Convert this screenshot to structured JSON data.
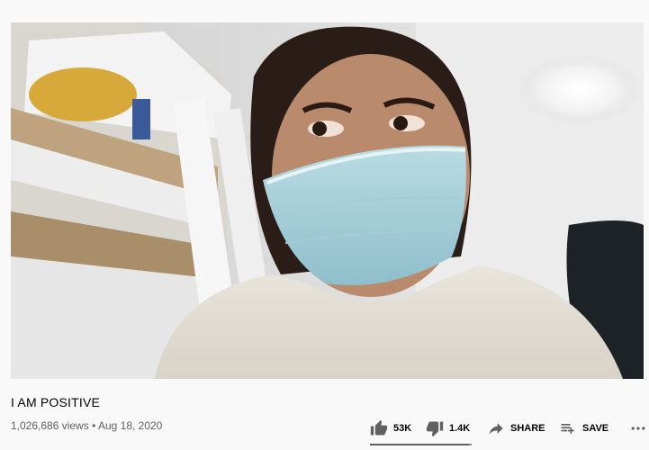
{
  "video": {
    "title": "I AM POSITIVE",
    "views": "1,026,686 views",
    "separator": "•",
    "date": "Aug 18, 2020"
  },
  "actions": {
    "like_count": "53K",
    "dislike_count": "1.4K",
    "share_label": "SHARE",
    "save_label": "SAVE"
  },
  "sentiment": {
    "like_ratio": 0.974
  },
  "colors": {
    "text_primary": "#030303",
    "text_secondary": "#606060",
    "icon": "#606060",
    "background": "#f9f9f9"
  },
  "icons": {
    "like": "thumb-up-icon",
    "dislike": "thumb-down-icon",
    "share": "share-arrow-icon",
    "save": "playlist-add-icon",
    "more": "more-horizontal-icon"
  }
}
